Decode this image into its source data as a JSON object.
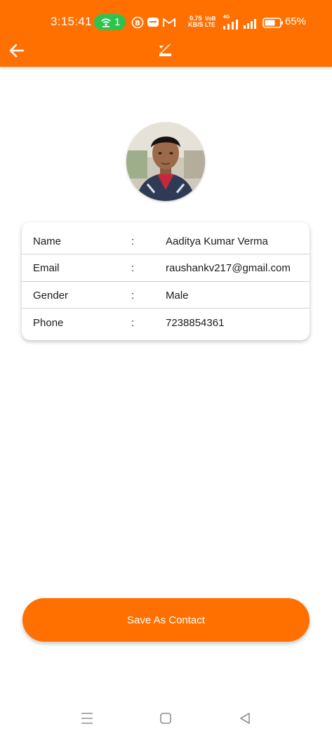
{
  "status_bar": {
    "time": "3:15:41",
    "hotspot_count": "1",
    "net_speed_value": "0.75",
    "net_speed_unit": "KB/S",
    "volte_top": "VoB",
    "volte_bottom": "LTE",
    "network_type": "4G",
    "battery_percent": "65%",
    "icons": [
      "hotspot-icon",
      "b-app-icon",
      "chat-app-icon",
      "gmail-icon",
      "signal-sim1-icon",
      "signal-sim2-icon",
      "battery-icon"
    ]
  },
  "app_bar": {
    "background_color": "#ff7000",
    "back_icon": "arrow-left-icon",
    "logo_icon": "z-logo-icon"
  },
  "profile": {
    "avatar": "profile-photo",
    "fields": [
      {
        "label": "Name",
        "separator": ":",
        "value": "Aaditya Kumar Verma"
      },
      {
        "label": "Email",
        "separator": ":",
        "value": "raushankv217@gmail.com"
      },
      {
        "label": "Gender",
        "separator": ":",
        "value": "Male"
      },
      {
        "label": "Phone",
        "separator": ":",
        "value": "7238854361"
      }
    ]
  },
  "actions": {
    "save_label": "Save As Contact",
    "accent_color": "#ff7000"
  },
  "system_nav": {
    "icons": [
      "menu-icon",
      "home-square-icon",
      "back-triangle-icon"
    ]
  }
}
